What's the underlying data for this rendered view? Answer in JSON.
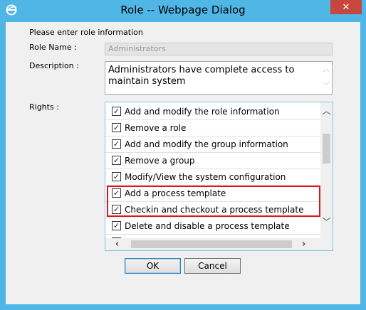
{
  "window": {
    "title": "Role -- Webpage Dialog",
    "close_label": "✕",
    "app_icon": "ie-icon",
    "accent_color": "#4fb6e6"
  },
  "form": {
    "intro": "Please enter role information",
    "role_name_label": "Role Name :",
    "role_name_value": "Administrators",
    "description_label": "Description :",
    "description_value": "Administrators have complete access to maintain system",
    "rights_label": "Rights :"
  },
  "rights": [
    {
      "label": "Add and modify the role information",
      "checked": true
    },
    {
      "label": "Remove a role",
      "checked": true
    },
    {
      "label": "Add and modify the group information",
      "checked": true
    },
    {
      "label": "Remove a group",
      "checked": true
    },
    {
      "label": "Modify/View the system configuration",
      "checked": true
    },
    {
      "label": "Add a process template",
      "checked": true
    },
    {
      "label": "Checkin and checkout a process template",
      "checked": true
    },
    {
      "label": "Delete and disable a process template",
      "checked": true
    }
  ],
  "highlight_color": "#e0141b",
  "buttons": {
    "ok": "OK",
    "cancel": "Cancel"
  }
}
